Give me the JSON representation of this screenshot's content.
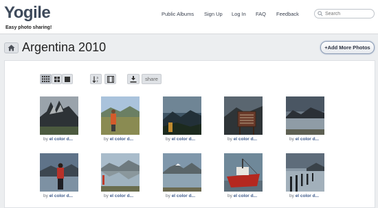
{
  "header": {
    "logo": "Yogile",
    "tagline": "Easy photo sharing!",
    "nav": [
      "Public Albums",
      "Sign Up",
      "Log In",
      "FAQ",
      "Feedback"
    ],
    "search_placeholder": "Search"
  },
  "album": {
    "title": "Argentina 2010",
    "add_button": "+Add More Photos"
  },
  "toolbar": {
    "share_label": "share",
    "icons": [
      "grid-small-icon",
      "grid-medium-icon",
      "grid-large-icon",
      "sort-icon",
      "slideshow-icon",
      "download-icon"
    ]
  },
  "photos": [
    {
      "by": "by",
      "author": "el color d..."
    },
    {
      "by": "by",
      "author": "el color d..."
    },
    {
      "by": "by",
      "author": "el color d..."
    },
    {
      "by": "by",
      "author": "el color d..."
    },
    {
      "by": "by",
      "author": "el color d..."
    },
    {
      "by": "by",
      "author": "el color d..."
    },
    {
      "by": "by",
      "author": "el color d..."
    },
    {
      "by": "by",
      "author": "el color d..."
    },
    {
      "by": "by",
      "author": "el color d..."
    },
    {
      "by": "by",
      "author": "el color d..."
    }
  ],
  "colors": {
    "logo": "#3e4a5b",
    "caption_author": "#3d5a8a",
    "background": "#eceef0"
  }
}
